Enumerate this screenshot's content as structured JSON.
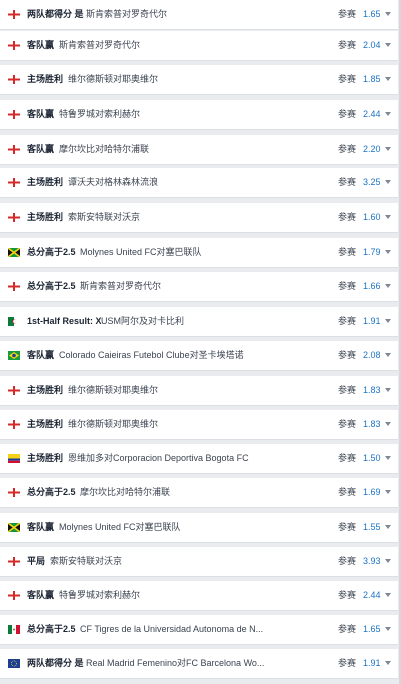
{
  "enter_label": "参赛",
  "rows": [
    {
      "flag": "england-flag",
      "market": "两队都得分 是",
      "match": "斯肯索普对罗奇代尔",
      "odds": "1.65"
    },
    {
      "flag": "england-flag",
      "market": "客队赢",
      "match": "斯肯索普对罗奇代尔",
      "odds": "2.04"
    },
    {
      "flag": "england-flag",
      "market": "主场胜利",
      "match": "维尔德斯顿对耶奥维尔",
      "odds": "1.85"
    },
    {
      "flag": "england-flag",
      "market": "客队赢",
      "match": "特鲁罗城对索利赫尔",
      "odds": "2.44"
    },
    {
      "flag": "england-flag",
      "market": "客队赢",
      "match": "摩尔坎比对哈特尔浦联",
      "odds": "2.20"
    },
    {
      "flag": "england-flag",
      "market": "主场胜利",
      "match": "谭沃夫对格林森林流浪",
      "odds": "3.25"
    },
    {
      "flag": "england-flag",
      "market": "主场胜利",
      "match": "索斯安特联对沃京",
      "odds": "1.60"
    },
    {
      "flag": "jamaica-flag",
      "market": "总分高于2.5",
      "match": "Molynes United FC对塞巴联队",
      "odds": "1.79"
    },
    {
      "flag": "england-flag",
      "market": "总分高于2.5",
      "match": "斯肯索普对罗奇代尔",
      "odds": "1.66"
    },
    {
      "flag": "algeria-flag",
      "market": "1st-Half Result: X",
      "match": "USM阿尔及对卡比利",
      "odds": "1.91"
    },
    {
      "flag": "brazil-flag",
      "market": "客队赢",
      "match": "Colorado Caieiras Futebol Clube对圣卡埃塔诺",
      "odds": "2.08"
    },
    {
      "flag": "england-flag",
      "market": "主场胜利",
      "match": "维尔德斯顿对耶奥维尔",
      "odds": "1.83"
    },
    {
      "flag": "england-flag",
      "market": "主场胜利",
      "match": "维尔德斯顿对耶奥维尔",
      "odds": "1.83"
    },
    {
      "flag": "colombia-flag",
      "market": "主场胜利",
      "match": "恩维加多对Corporacion Deportiva Bogota FC",
      "odds": "1.50"
    },
    {
      "flag": "england-flag",
      "market": "总分高于2.5",
      "match": "摩尔坎比对哈特尔浦联",
      "odds": "1.69"
    },
    {
      "flag": "jamaica-flag",
      "market": "客队赢",
      "match": "Molynes United FC对塞巴联队",
      "odds": "1.55"
    },
    {
      "flag": "england-flag",
      "market": "平局",
      "match": "索斯安特联对沃京",
      "odds": "3.93"
    },
    {
      "flag": "england-flag",
      "market": "客队赢",
      "match": "特鲁罗城对索利赫尔",
      "odds": "2.44"
    },
    {
      "flag": "mexico-flag",
      "market": "总分高于2.5",
      "match": "CF Tigres de la Universidad Autonoma de N...",
      "odds": "1.65"
    },
    {
      "flag": "eu-flag",
      "market": "两队都得分 是",
      "match": "Real Madrid Femenino对FC Barcelona Wo...",
      "odds": "1.91"
    }
  ]
}
